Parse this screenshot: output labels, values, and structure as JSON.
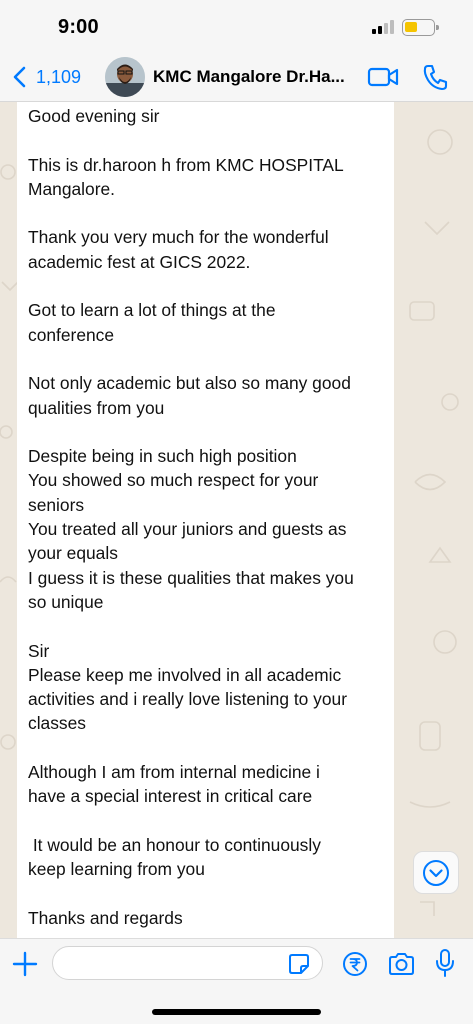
{
  "status_bar": {
    "time": "9:00"
  },
  "header": {
    "back_count": "1,109",
    "contact_name": "KMC Mangalore Dr.Ha..."
  },
  "message": {
    "lines": [
      "Good evening sir",
      "",
      "This is dr.haroon h from KMC HOSPITAL",
      "Mangalore.",
      "",
      "Thank you very much for the wonderful",
      "academic fest at GICS 2022.",
      "",
      "Got to learn a lot of things at the",
      "conference",
      "",
      "Not only academic but also so many good",
      "qualities from you",
      "",
      "Despite being in such high position",
      "You showed so much respect for your",
      "seniors",
      "You treated all your juniors and guests as",
      "your equals",
      "I guess it is these qualities that makes you",
      "so unique",
      "",
      "Sir",
      "Please keep me involved in all academic",
      "activities and i really love listening to your",
      "classes",
      "",
      "Although I am from internal medicine i",
      "have a special interest in critical care",
      "",
      " It would be an honour to continuously",
      "keep learning from you",
      "",
      "Thanks and regards"
    ]
  },
  "input": {
    "value": "",
    "placeholder": ""
  },
  "icons": {
    "back": "chevron-left-icon",
    "video": "video-call-icon",
    "call": "phone-icon",
    "plus": "plus-icon",
    "sticker": "sticker-icon",
    "payment": "rupee-icon",
    "camera": "camera-icon",
    "mic": "microphone-icon",
    "scroll": "chevron-down-icon"
  },
  "colors": {
    "accent": "#007aff",
    "battery": "#f5c400",
    "chat_background": "#ede7dd",
    "bubble": "#ffffff"
  }
}
